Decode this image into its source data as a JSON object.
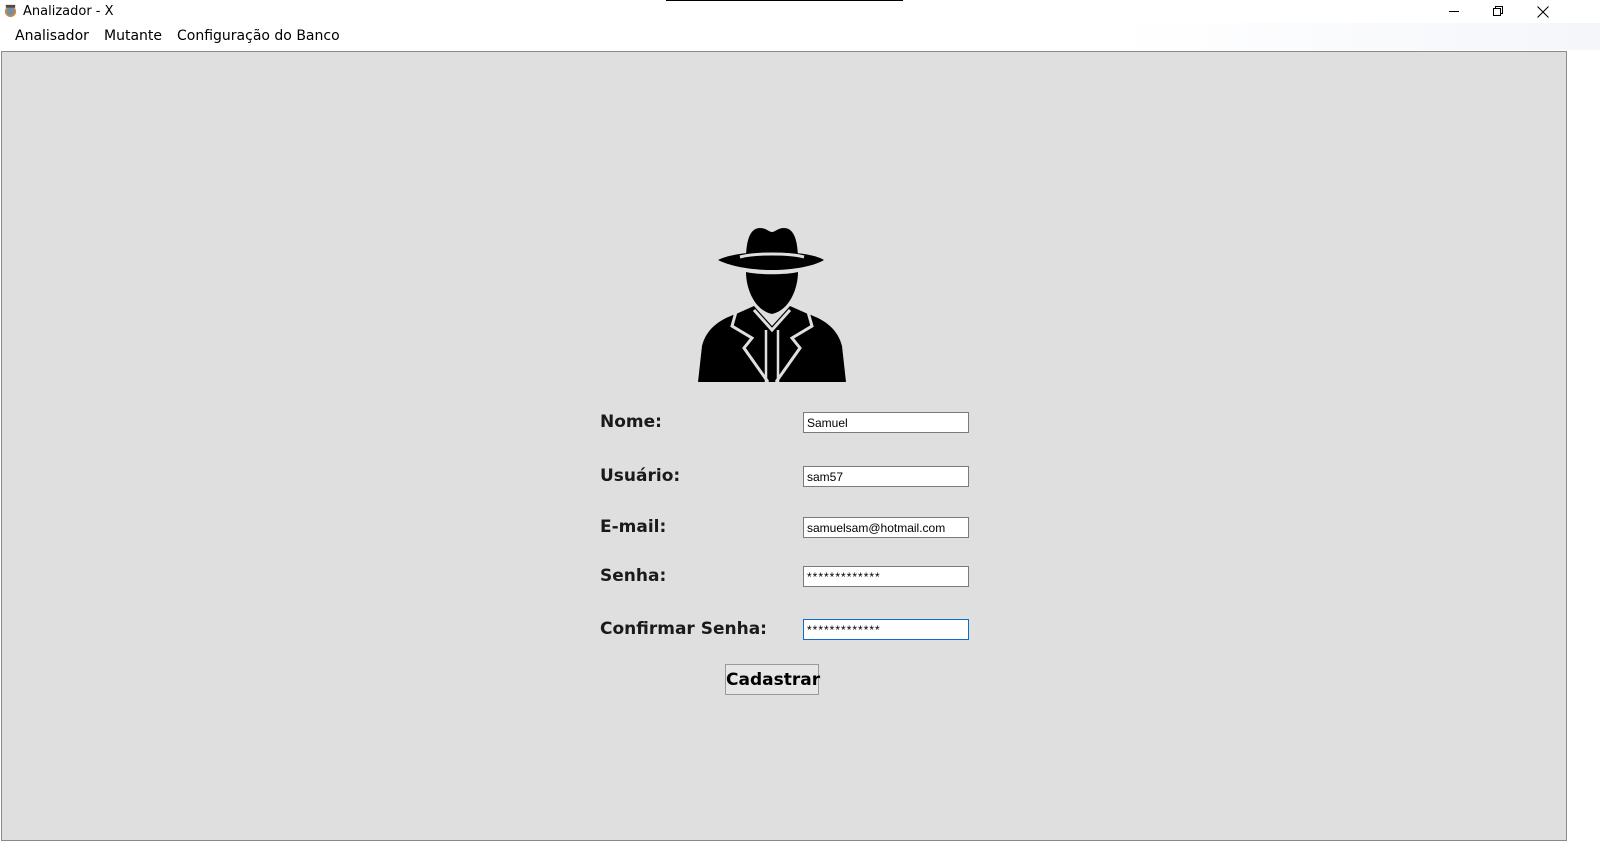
{
  "window": {
    "title": "Analizador - X",
    "controls": [
      "minimize",
      "restore",
      "close"
    ]
  },
  "menu": {
    "items": [
      {
        "label": "Analisador"
      },
      {
        "label": "Mutante"
      },
      {
        "label": "Configuração do Banco"
      }
    ]
  },
  "form": {
    "logo_icon": "spy-icon",
    "fields": [
      {
        "label": "Nome:",
        "value": "Samuel",
        "type": "text"
      },
      {
        "label": "Usuário:",
        "value": "sam57",
        "type": "text"
      },
      {
        "label": "E-mail:",
        "value": "samuelsam@hotmail.com",
        "type": "text"
      },
      {
        "label": "Senha:",
        "value": "*************",
        "type": "password"
      },
      {
        "label": "Confirmar Senha:",
        "value": "*************",
        "type": "password",
        "focused": true
      }
    ],
    "submit_label": "Cadastrar"
  },
  "colors": {
    "background": "#dfdfdf",
    "focus_border": "#0b6ecf",
    "field_border": "#7a7a7a"
  }
}
